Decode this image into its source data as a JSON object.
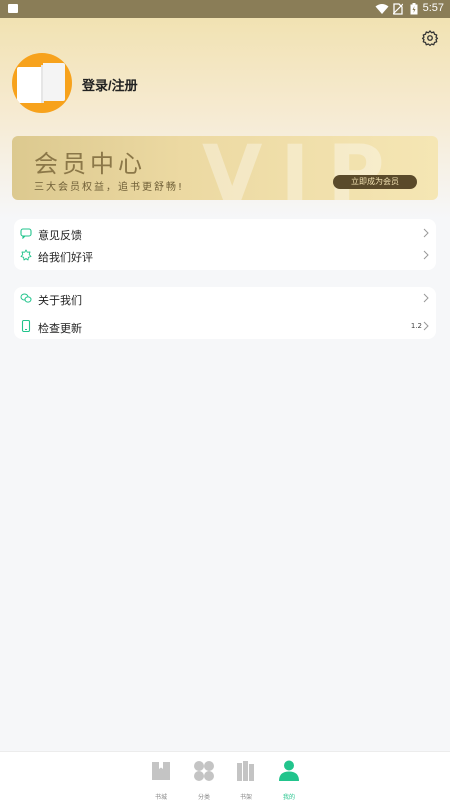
{
  "status_bar": {
    "time": "5:57"
  },
  "profile": {
    "login_label": "登录/注册"
  },
  "vip": {
    "title": "会员中心",
    "subtitle": "三大会员权益，追书更舒畅!",
    "watermark": "VIP",
    "button_label": "立即成为会员"
  },
  "menu_group1": [
    {
      "label": "意见反馈",
      "icon": "feedback-icon"
    },
    {
      "label": "给我们好评",
      "icon": "rating-icon"
    }
  ],
  "menu_group2": [
    {
      "label": "关于我们",
      "icon": "about-icon"
    },
    {
      "label": "检查更新",
      "icon": "phone-icon",
      "version": "1.2"
    }
  ],
  "tabs": [
    {
      "label": "书城",
      "icon": "bookstore-icon"
    },
    {
      "label": "分类",
      "icon": "category-icon"
    },
    {
      "label": "书架",
      "icon": "bookshelf-icon"
    },
    {
      "label": "我的",
      "icon": "profile-icon",
      "active": true
    }
  ],
  "colors": {
    "accent": "#22c48c",
    "status_bar": "#8a7d57",
    "avatar": "#f7a21c"
  }
}
